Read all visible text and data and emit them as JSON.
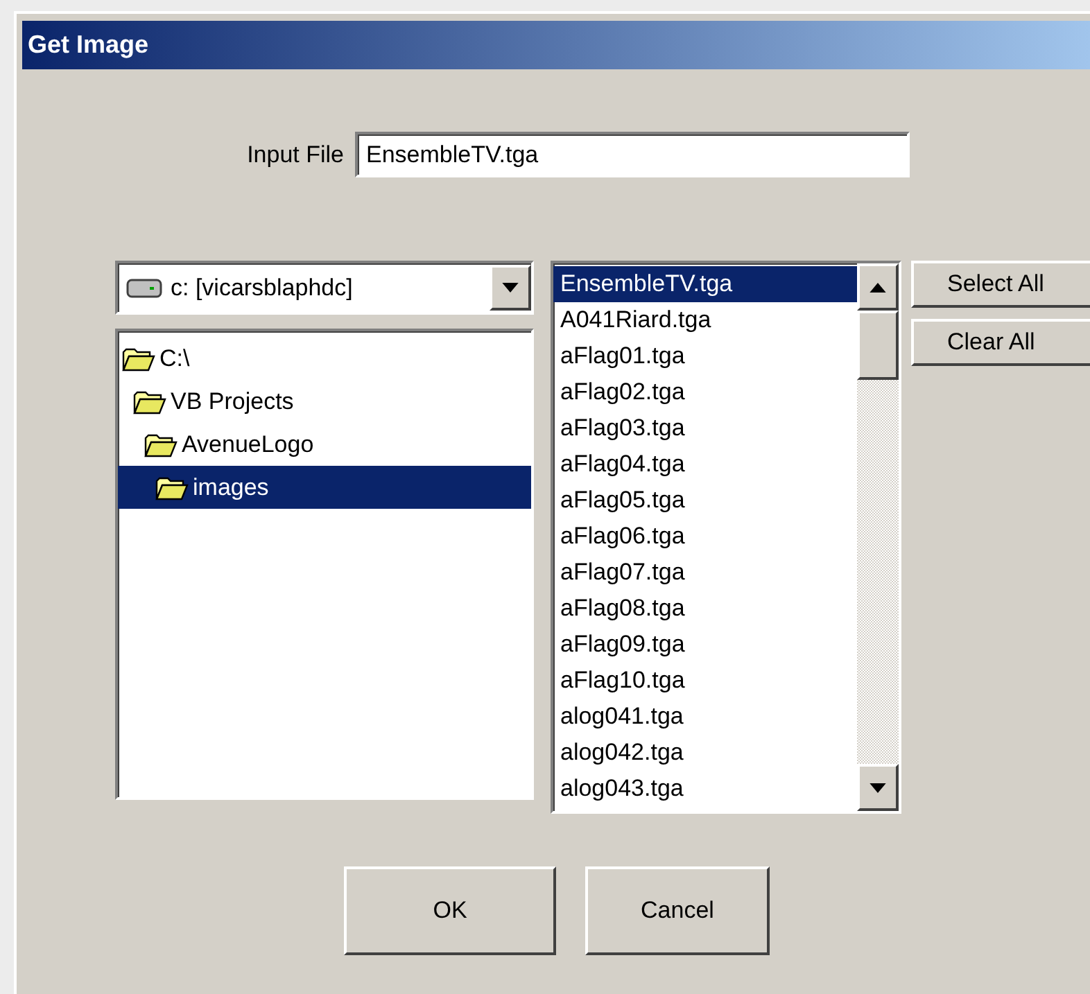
{
  "window": {
    "title": "Get Image"
  },
  "input_file": {
    "label": "Input File",
    "value": "EnsembleTV.tga"
  },
  "drive": {
    "value": "c: [vicarsblaphdc]"
  },
  "folders": [
    {
      "name": "C:\\",
      "selected": false,
      "children": [
        {
          "name": "VB Projects",
          "selected": false,
          "children": [
            {
              "name": "AvenueLogo",
              "selected": false,
              "children": [
                {
                  "name": "images",
                  "selected": true
                }
              ]
            }
          ]
        }
      ]
    }
  ],
  "files": [
    {
      "name": "EnsembleTV.tga",
      "selected": true
    },
    {
      "name": "A041Riard.tga",
      "selected": false
    },
    {
      "name": "aFlag01.tga",
      "selected": false
    },
    {
      "name": "aFlag02.tga",
      "selected": false
    },
    {
      "name": "aFlag03.tga",
      "selected": false
    },
    {
      "name": "aFlag04.tga",
      "selected": false
    },
    {
      "name": "aFlag05.tga",
      "selected": false
    },
    {
      "name": "aFlag06.tga",
      "selected": false
    },
    {
      "name": "aFlag07.tga",
      "selected": false
    },
    {
      "name": "aFlag08.tga",
      "selected": false
    },
    {
      "name": "aFlag09.tga",
      "selected": false
    },
    {
      "name": "aFlag10.tga",
      "selected": false
    },
    {
      "name": "alog041.tga",
      "selected": false
    },
    {
      "name": "alog042.tga",
      "selected": false
    },
    {
      "name": "alog043.tga",
      "selected": false
    }
  ],
  "side_buttons": [
    "Select All",
    "Clear All"
  ],
  "buttons": [
    "OK",
    "Cancel"
  ]
}
